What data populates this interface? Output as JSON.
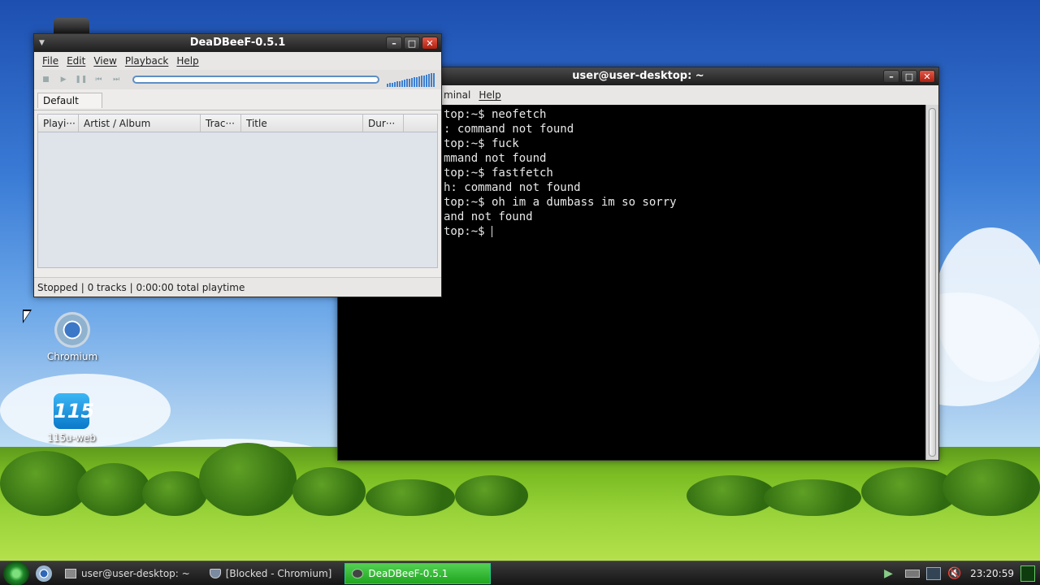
{
  "desktop": {
    "icons": [
      {
        "label": "Chromium",
        "icon": "chromium-icon"
      },
      {
        "label": "115u-web",
        "icon": "115-icon",
        "glyph": "115"
      }
    ]
  },
  "deadbeef": {
    "title": "DeaDBeeF-0.5.1",
    "menu": [
      "File",
      "Edit",
      "View",
      "Playback",
      "Help"
    ],
    "toolbar_icons": [
      "stop-icon",
      "play-icon",
      "pause-icon",
      "prev-icon",
      "next-icon"
    ],
    "tab": "Default",
    "columns": [
      "Playi···",
      "Artist / Album",
      "Trac···",
      "Title",
      "Dur···"
    ],
    "status": "Stopped | 0 tracks | 0:00:00 total playtime"
  },
  "terminal": {
    "title": "user@user-desktop: ~",
    "menu": [
      "minal",
      "Help"
    ],
    "lines": [
      "top:~$ neofetch",
      ": command not found",
      "top:~$ fuck",
      "mmand not found",
      "top:~$ fastfetch",
      "h: command not found",
      "top:~$ oh im a dumbass im so sorry",
      "and not found",
      "top:~$ "
    ]
  },
  "taskbar": {
    "tasks": [
      {
        "label": "user@user-desktop: ~",
        "icon": "terminal-icon",
        "active": false
      },
      {
        "label": "[Blocked - Chromium]",
        "icon": "shield-icon",
        "active": false
      },
      {
        "label": "DeaDBeeF-0.5.1",
        "icon": "deadbeef-icon",
        "active": true
      }
    ],
    "clock": "23:20:59"
  },
  "colors": {
    "active_task": "#2db82d",
    "terminal_bg": "#000000",
    "volume_blue": "#3d7fd0"
  }
}
